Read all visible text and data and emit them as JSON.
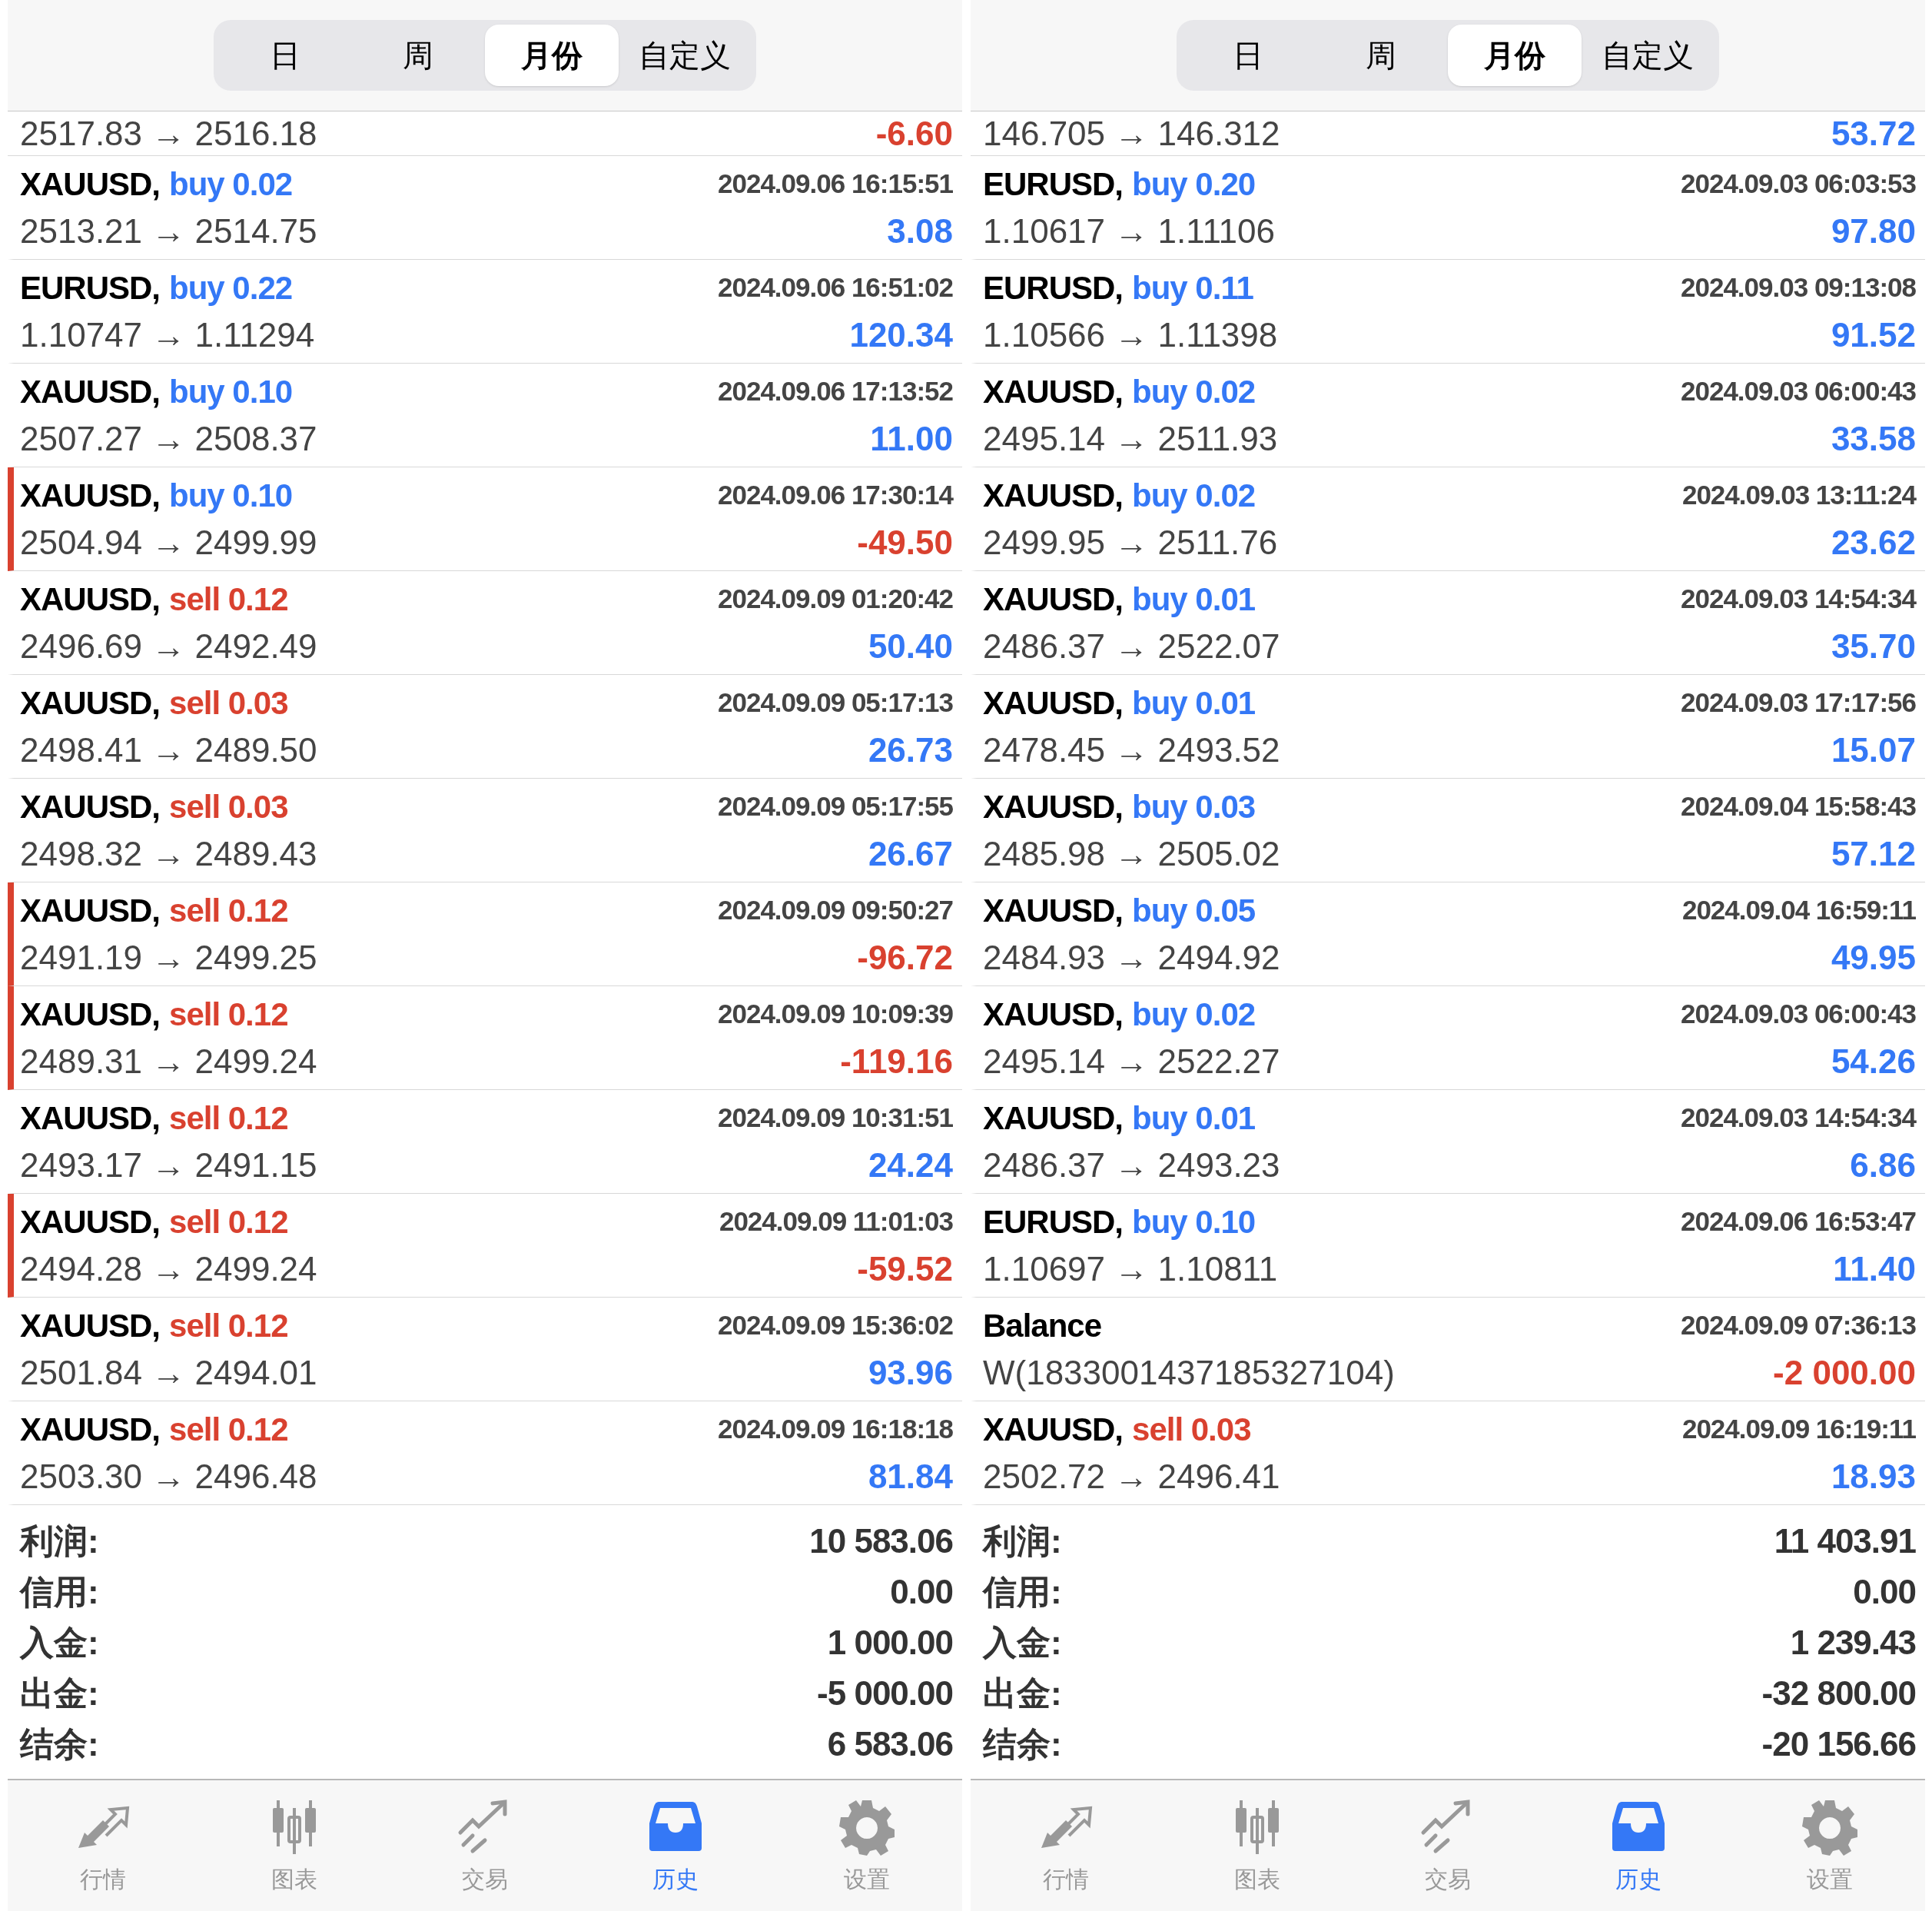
{
  "panels": [
    {
      "tabs": [
        {
          "label": "日",
          "selected": false
        },
        {
          "label": "周",
          "selected": false
        },
        {
          "label": "月份",
          "selected": true
        },
        {
          "label": "自定义",
          "selected": false
        }
      ],
      "partial_row": {
        "prices": "2517.83 → 2516.18",
        "profit": "-6.60",
        "negative": true
      },
      "rows": [
        {
          "kind": "buy",
          "symbol": "XAUUSD,",
          "action": "buy 0.02",
          "time": "2024.09.06 16:15:51",
          "prices": "2513.21 → 2514.75",
          "profit": "3.08",
          "negative": false,
          "flagged": false
        },
        {
          "kind": "buy",
          "symbol": "EURUSD,",
          "action": "buy 0.22",
          "time": "2024.09.06 16:51:02",
          "prices": "1.10747 → 1.11294",
          "profit": "120.34",
          "negative": false,
          "flagged": false
        },
        {
          "kind": "buy",
          "symbol": "XAUUSD,",
          "action": "buy 0.10",
          "time": "2024.09.06 17:13:52",
          "prices": "2507.27 → 2508.37",
          "profit": "11.00",
          "negative": false,
          "flagged": false
        },
        {
          "kind": "buy",
          "symbol": "XAUUSD,",
          "action": "buy 0.10",
          "time": "2024.09.06 17:30:14",
          "prices": "2504.94 → 2499.99",
          "profit": "-49.50",
          "negative": true,
          "flagged": true
        },
        {
          "kind": "sell",
          "symbol": "XAUUSD,",
          "action": "sell 0.12",
          "time": "2024.09.09 01:20:42",
          "prices": "2496.69 → 2492.49",
          "profit": "50.40",
          "negative": false,
          "flagged": false
        },
        {
          "kind": "sell",
          "symbol": "XAUUSD,",
          "action": "sell 0.03",
          "time": "2024.09.09 05:17:13",
          "prices": "2498.41 → 2489.50",
          "profit": "26.73",
          "negative": false,
          "flagged": false
        },
        {
          "kind": "sell",
          "symbol": "XAUUSD,",
          "action": "sell 0.03",
          "time": "2024.09.09 05:17:55",
          "prices": "2498.32 → 2489.43",
          "profit": "26.67",
          "negative": false,
          "flagged": false
        },
        {
          "kind": "sell",
          "symbol": "XAUUSD,",
          "action": "sell 0.12",
          "time": "2024.09.09 09:50:27",
          "prices": "2491.19 → 2499.25",
          "profit": "-96.72",
          "negative": true,
          "flagged": true
        },
        {
          "kind": "sell",
          "symbol": "XAUUSD,",
          "action": "sell 0.12",
          "time": "2024.09.09 10:09:39",
          "prices": "2489.31 → 2499.24",
          "profit": "-119.16",
          "negative": true,
          "flagged": true
        },
        {
          "kind": "sell",
          "symbol": "XAUUSD,",
          "action": "sell 0.12",
          "time": "2024.09.09 10:31:51",
          "prices": "2493.17 → 2491.15",
          "profit": "24.24",
          "negative": false,
          "flagged": false
        },
        {
          "kind": "sell",
          "symbol": "XAUUSD,",
          "action": "sell 0.12",
          "time": "2024.09.09 11:01:03",
          "prices": "2494.28 → 2499.24",
          "profit": "-59.52",
          "negative": true,
          "flagged": true
        },
        {
          "kind": "sell",
          "symbol": "XAUUSD,",
          "action": "sell 0.12",
          "time": "2024.09.09 15:36:02",
          "prices": "2501.84 → 2494.01",
          "profit": "93.96",
          "negative": false,
          "flagged": false
        },
        {
          "kind": "sell",
          "symbol": "XAUUSD,",
          "action": "sell 0.12",
          "time": "2024.09.09 16:18:18",
          "prices": "2503.30 → 2496.48",
          "profit": "81.84",
          "negative": false,
          "flagged": false
        }
      ],
      "summary": [
        {
          "label": "利润:",
          "value": "10 583.06"
        },
        {
          "label": "信用:",
          "value": "0.00"
        },
        {
          "label": "入金:",
          "value": "1 000.00"
        },
        {
          "label": "出金:",
          "value": "-5 000.00"
        },
        {
          "label": "结余:",
          "value": "6 583.06"
        }
      ],
      "nav": [
        {
          "label": "行情",
          "selected": false
        },
        {
          "label": "图表",
          "selected": false
        },
        {
          "label": "交易",
          "selected": false
        },
        {
          "label": "历史",
          "selected": true
        },
        {
          "label": "设置",
          "selected": false
        }
      ]
    },
    {
      "tabs": [
        {
          "label": "日",
          "selected": false
        },
        {
          "label": "周",
          "selected": false
        },
        {
          "label": "月份",
          "selected": true
        },
        {
          "label": "自定义",
          "selected": false
        }
      ],
      "partial_row": {
        "prices": "146.705 → 146.312",
        "profit": "53.72",
        "negative": false
      },
      "rows": [
        {
          "kind": "buy",
          "symbol": "EURUSD,",
          "action": "buy 0.20",
          "time": "2024.09.03 06:03:53",
          "prices": "1.10617 → 1.11106",
          "profit": "97.80",
          "negative": false,
          "flagged": false
        },
        {
          "kind": "buy",
          "symbol": "EURUSD,",
          "action": "buy 0.11",
          "time": "2024.09.03 09:13:08",
          "prices": "1.10566 → 1.11398",
          "profit": "91.52",
          "negative": false,
          "flagged": false
        },
        {
          "kind": "buy",
          "symbol": "XAUUSD,",
          "action": "buy 0.02",
          "time": "2024.09.03 06:00:43",
          "prices": "2495.14 → 2511.93",
          "profit": "33.58",
          "negative": false,
          "flagged": false
        },
        {
          "kind": "buy",
          "symbol": "XAUUSD,",
          "action": "buy 0.02",
          "time": "2024.09.03 13:11:24",
          "prices": "2499.95 → 2511.76",
          "profit": "23.62",
          "negative": false,
          "flagged": false
        },
        {
          "kind": "buy",
          "symbol": "XAUUSD,",
          "action": "buy 0.01",
          "time": "2024.09.03 14:54:34",
          "prices": "2486.37 → 2522.07",
          "profit": "35.70",
          "negative": false,
          "flagged": false
        },
        {
          "kind": "buy",
          "symbol": "XAUUSD,",
          "action": "buy 0.01",
          "time": "2024.09.03 17:17:56",
          "prices": "2478.45 → 2493.52",
          "profit": "15.07",
          "negative": false,
          "flagged": false
        },
        {
          "kind": "buy",
          "symbol": "XAUUSD,",
          "action": "buy 0.03",
          "time": "2024.09.04 15:58:43",
          "prices": "2485.98 → 2505.02",
          "profit": "57.12",
          "negative": false,
          "flagged": false
        },
        {
          "kind": "buy",
          "symbol": "XAUUSD,",
          "action": "buy 0.05",
          "time": "2024.09.04 16:59:11",
          "prices": "2484.93 → 2494.92",
          "profit": "49.95",
          "negative": false,
          "flagged": false
        },
        {
          "kind": "buy",
          "symbol": "XAUUSD,",
          "action": "buy 0.02",
          "time": "2024.09.03 06:00:43",
          "prices": "2495.14 → 2522.27",
          "profit": "54.26",
          "negative": false,
          "flagged": false
        },
        {
          "kind": "buy",
          "symbol": "XAUUSD,",
          "action": "buy 0.01",
          "time": "2024.09.03 14:54:34",
          "prices": "2486.37 → 2493.23",
          "profit": "6.86",
          "negative": false,
          "flagged": false
        },
        {
          "kind": "buy",
          "symbol": "EURUSD,",
          "action": "buy 0.10",
          "time": "2024.09.06 16:53:47",
          "prices": "1.10697 → 1.10811",
          "profit": "11.40",
          "negative": false,
          "flagged": false
        },
        {
          "kind": "balance",
          "symbol": "Balance",
          "time": "2024.09.09 07:36:13",
          "prices": "W(1833001437185327104)",
          "profit": "-2 000.00",
          "negative": true,
          "flagged": false
        },
        {
          "kind": "sell",
          "symbol": "XAUUSD,",
          "action": "sell 0.03",
          "time": "2024.09.09 16:19:11",
          "prices": "2502.72 → 2496.41",
          "profit": "18.93",
          "negative": false,
          "flagged": false
        }
      ],
      "summary": [
        {
          "label": "利润:",
          "value": "11 403.91"
        },
        {
          "label": "信用:",
          "value": "0.00"
        },
        {
          "label": "入金:",
          "value": "1 239.43"
        },
        {
          "label": "出金:",
          "value": "-32 800.00"
        },
        {
          "label": "结余:",
          "value": "-20 156.66"
        }
      ],
      "nav": [
        {
          "label": "行情",
          "selected": false
        },
        {
          "label": "图表",
          "selected": false
        },
        {
          "label": "交易",
          "selected": false
        },
        {
          "label": "历史",
          "selected": true
        },
        {
          "label": "设置",
          "selected": false
        }
      ]
    }
  ]
}
